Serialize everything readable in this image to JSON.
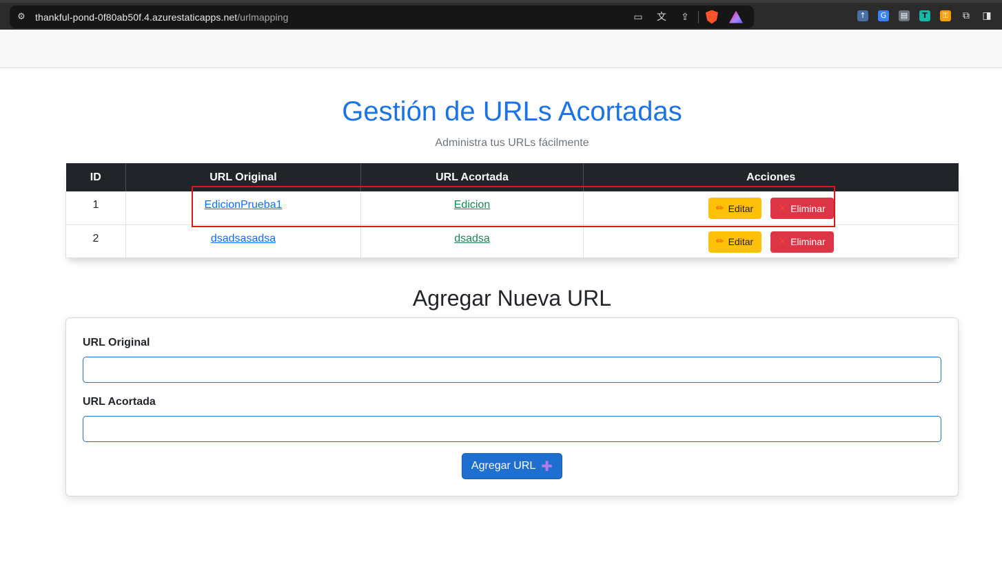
{
  "browser": {
    "url_host": "thankful-pond-0f80ab50f.4.azurestaticapps.net",
    "url_path": "/urlmapping"
  },
  "page": {
    "title": "Gestión de URLs Acortadas",
    "subtitle": "Administra tus URLs fácilmente"
  },
  "table": {
    "headers": [
      "ID",
      "URL Original",
      "URL Acortada",
      "Acciones"
    ],
    "rows": [
      {
        "id": "1",
        "original": "EdicionPrueba1",
        "short": "Edicion",
        "edit_label": "Editar",
        "delete_label": "Eliminar"
      },
      {
        "id": "2",
        "original": "dsadsasadsa",
        "short": "dsadsa",
        "edit_label": "Editar",
        "delete_label": "Eliminar"
      }
    ]
  },
  "form": {
    "section_title": "Agregar Nueva URL",
    "original_label": "URL Original",
    "original_value": "",
    "short_label": "URL Acortada",
    "short_value": "",
    "submit_label": "Agregar URL"
  },
  "icons": {
    "edit": "pencil-icon",
    "delete": "x-icon",
    "add": "plus-icon"
  },
  "colors": {
    "title": "#1a73e8",
    "edit_button": "#ffc107",
    "delete_button": "#dc3545",
    "submit_button": "#1f6fd1",
    "highlight": "#e01515"
  }
}
